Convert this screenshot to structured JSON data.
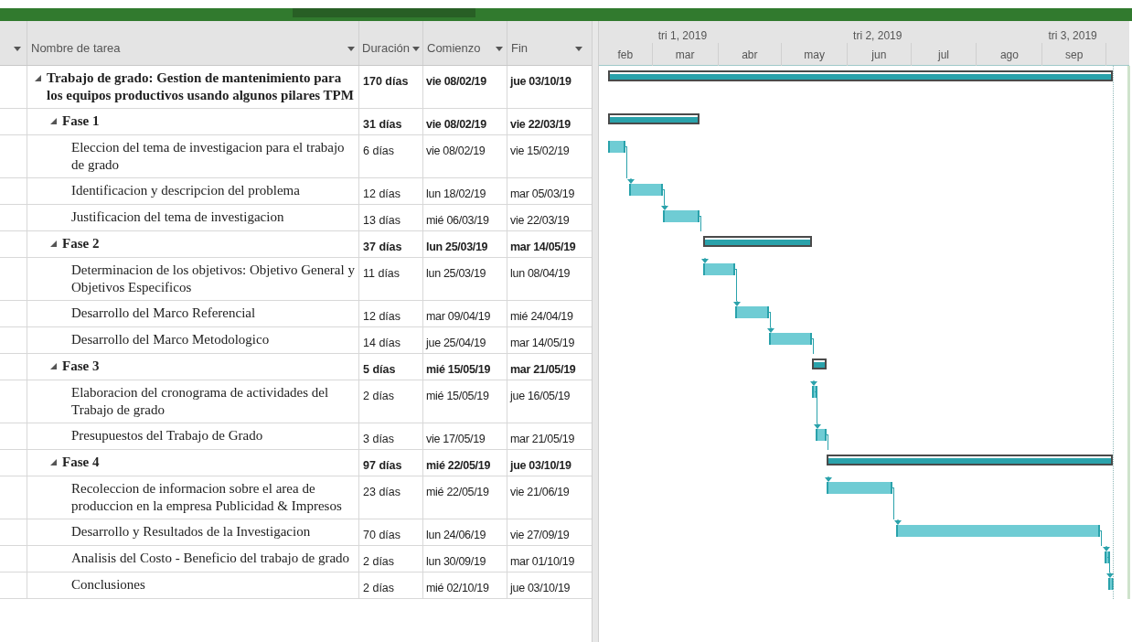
{
  "columns": [
    "Nombre de tarea",
    "Duración",
    "Comienzo",
    "Fin"
  ],
  "timescale": {
    "quarters": [
      "tri 1, 2019",
      "tri 2, 2019",
      "tri 3, 2019"
    ],
    "months": [
      "feb",
      "mar",
      "abr",
      "may",
      "jun",
      "jul",
      "ago",
      "sep"
    ]
  },
  "tasks": [
    {
      "kind": "summary",
      "name": "Trabajo de grado: Gestion de mantenimiento para los equipos productivos usando algunos pilares TPM",
      "duration": "170 días",
      "start": "vie 08/02/19",
      "end": "jue 03/10/19",
      "expanded": true,
      "children": [
        {
          "kind": "summary",
          "name": "Fase 1",
          "duration": "31 días",
          "start": "vie 08/02/19",
          "end": "vie 22/03/19",
          "expanded": true,
          "children": [
            {
              "kind": "task",
              "name": "Eleccion del tema de investigacion para el trabajo de grado",
              "duration": "6 días",
              "start": "vie 08/02/19",
              "end": "vie 15/02/19"
            },
            {
              "kind": "task",
              "name": "Identificacion y descripcion del problema",
              "duration": "12 días",
              "start": "lun 18/02/19",
              "end": "mar 05/03/19"
            },
            {
              "kind": "task",
              "name": "Justificacion del tema de investigacion",
              "duration": "13 días",
              "start": "mié 06/03/19",
              "end": "vie 22/03/19"
            }
          ]
        },
        {
          "kind": "summary",
          "name": "Fase 2",
          "duration": "37 días",
          "start": "lun 25/03/19",
          "end": "mar 14/05/19",
          "expanded": true,
          "children": [
            {
              "kind": "task",
              "name": "Determinacion de los objetivos: Objetivo General y Objetivos Especificos",
              "duration": "11 días",
              "start": "lun 25/03/19",
              "end": "lun 08/04/19"
            },
            {
              "kind": "task",
              "name": "Desarrollo del Marco Referencial",
              "duration": "12 días",
              "start": "mar 09/04/19",
              "end": "mié 24/04/19"
            },
            {
              "kind": "task",
              "name": "Desarrollo del Marco Metodologico",
              "duration": "14 días",
              "start": "jue 25/04/19",
              "end": "mar 14/05/19"
            }
          ]
        },
        {
          "kind": "summary",
          "name": "Fase 3",
          "duration": "5 días",
          "start": "mié 15/05/19",
          "end": "mar 21/05/19",
          "expanded": true,
          "children": [
            {
              "kind": "task",
              "name": "Elaboracion del cronograma de actividades del Trabajo de grado",
              "duration": "2 días",
              "start": "mié 15/05/19",
              "end": "jue 16/05/19"
            },
            {
              "kind": "task",
              "name": "Presupuestos del Trabajo de Grado",
              "duration": "3 días",
              "start": "vie 17/05/19",
              "end": "mar 21/05/19"
            }
          ]
        },
        {
          "kind": "summary",
          "name": "Fase 4",
          "duration": "97 días",
          "start": "mié 22/05/19",
          "end": "jue 03/10/19",
          "expanded": true,
          "children": [
            {
              "kind": "task",
              "name": "Recoleccion de informacion sobre el area de produccion en la empresa Publicidad & Impresos",
              "duration": "23 días",
              "start": "mié 22/05/19",
              "end": "vie 21/06/19"
            },
            {
              "kind": "task",
              "name": "Desarrollo y Resultados de la Investigacion",
              "duration": "70 días",
              "start": "lun 24/06/19",
              "end": "vie 27/09/19"
            },
            {
              "kind": "task",
              "name": "Analisis del Costo - Beneficio del trabajo de grado",
              "duration": "2 días",
              "start": "lun 30/09/19",
              "end": "mar 01/10/19"
            },
            {
              "kind": "task",
              "name": "Conclusiones",
              "duration": "2 días",
              "start": "mié 02/10/19",
              "end": "jue 03/10/19"
            }
          ]
        }
      ]
    }
  ]
}
